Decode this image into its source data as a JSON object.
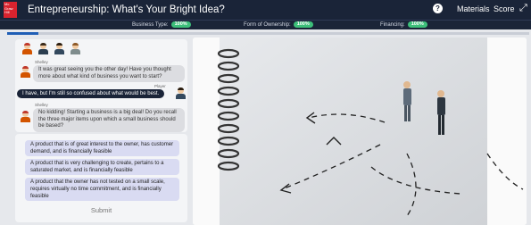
{
  "header": {
    "logo_text": "Mc Graw Hill",
    "title": "Entrepreneurship: What's Your Bright Idea?",
    "help_icon": "question-circle-icon",
    "materials": "Materials",
    "score": "Score",
    "expand_icon": "expand-arrows-icon"
  },
  "status": {
    "items": [
      {
        "label": "Business Type:",
        "value": "100%"
      },
      {
        "label": "Form of Ownership:",
        "value": "100%"
      },
      {
        "label": "Financing:",
        "value": "100%"
      }
    ],
    "badge_color": "#3dbf7a"
  },
  "progress": {
    "fraction": 0.06,
    "color": "#1f5eb5"
  },
  "chat": {
    "messages": [
      {
        "speaker": "Shelley",
        "text": "It was great seeing you the other day! Have you thought more about what kind of business you want to start?"
      },
      {
        "speaker": "Player",
        "text": "I have, but I'm still so confused about what would be best."
      },
      {
        "speaker": "Shelley",
        "text": "No kidding! Starting a business is a big deal! Do you recall the three major items upon which a small business should be based?"
      }
    ]
  },
  "choices": [
    "A product that is of great interest to the owner, has customer demand, and is financially feasible",
    "A product that is very challenging to create, pertains to a saturated market, and is financially feasible",
    "A product that the owner has not tested on a small scale, requires virtually no time commitment, and is financially feasible"
  ],
  "submit_label": "Submit",
  "colors": {
    "nav": "#1a2438",
    "choice_bg": "#d9dbf2",
    "panel_bg": "#f4f5f7"
  }
}
